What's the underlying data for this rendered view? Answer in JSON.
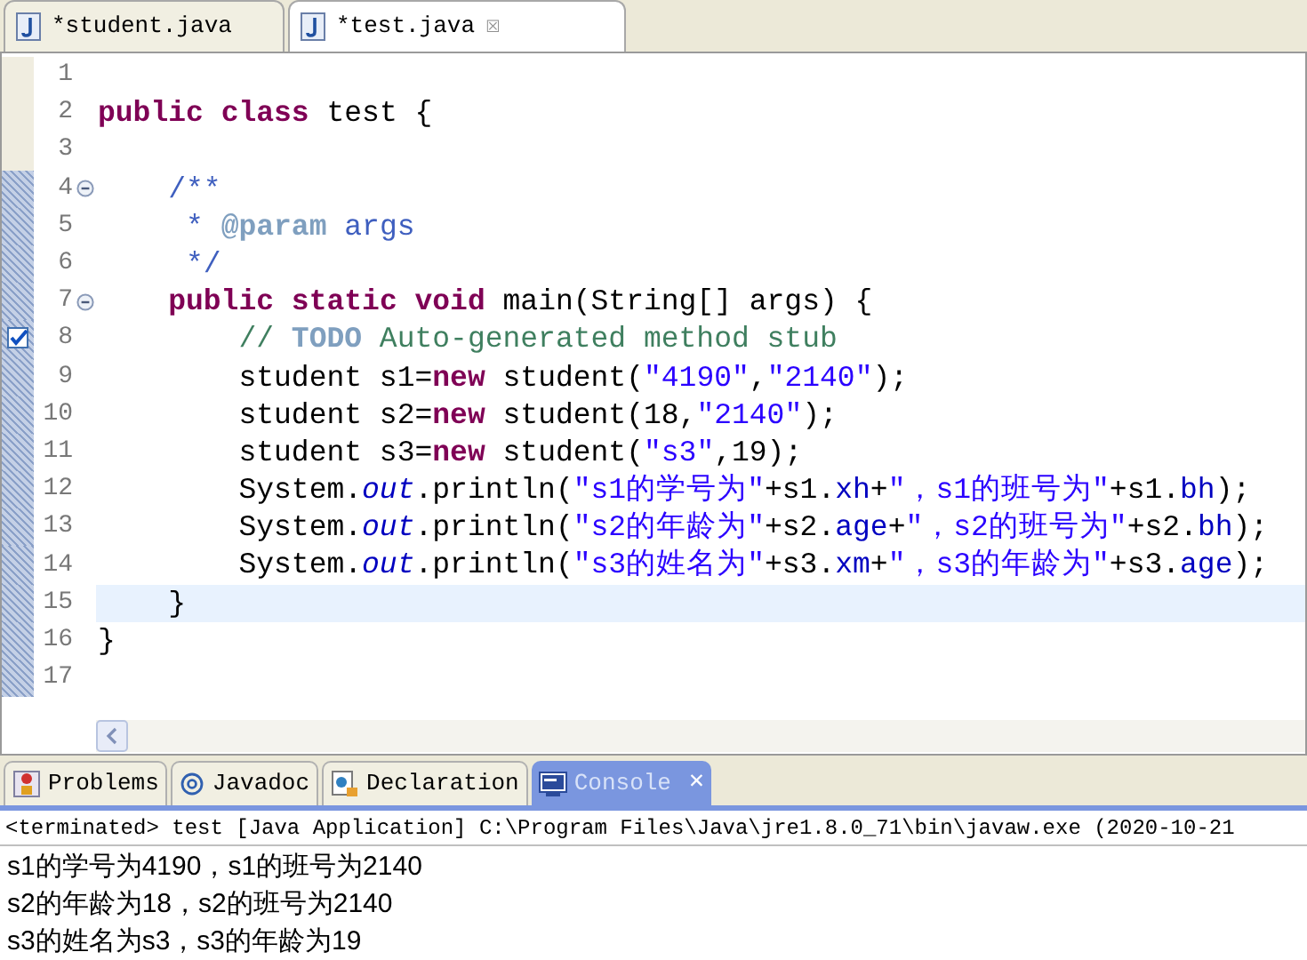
{
  "editor_tabs": [
    {
      "label": "*student.java",
      "selected": false
    },
    {
      "label": "*test.java",
      "selected": true,
      "close": "☒"
    }
  ],
  "code_lines": [
    {
      "number": "1",
      "current": false,
      "fold": false,
      "task": false,
      "in_range": false
    },
    {
      "number": "2",
      "current": false,
      "fold": false,
      "task": false,
      "in_range": false,
      "tokens": [
        {
          "kind": "keyword",
          "text": "public"
        },
        {
          "kind": "keyword",
          "text": " class"
        },
        {
          "kind": "plain",
          "text": " test {"
        }
      ]
    },
    {
      "number": "3",
      "current": false,
      "fold": false,
      "task": false,
      "in_range": false
    },
    {
      "number": "4",
      "current": false,
      "fold": true,
      "task": false,
      "in_range": true,
      "tokens": [
        {
          "kind": "javadoc",
          "text": "    /**"
        }
      ]
    },
    {
      "number": "5",
      "current": false,
      "fold": false,
      "task": false,
      "in_range": true,
      "tokens": [
        {
          "kind": "javadoc",
          "text": "     * "
        },
        {
          "kind": "doctag",
          "text": "@param"
        },
        {
          "kind": "javadoc",
          "text": " args"
        }
      ]
    },
    {
      "number": "6",
      "current": false,
      "fold": false,
      "task": false,
      "in_range": true,
      "tokens": [
        {
          "kind": "javadoc",
          "text": "     */"
        }
      ]
    },
    {
      "number": "7",
      "current": false,
      "fold": true,
      "task": false,
      "in_range": true,
      "tokens": [
        {
          "kind": "keyword",
          "text": "    public"
        },
        {
          "kind": "keyword",
          "text": " static"
        },
        {
          "kind": "keyword",
          "text": " void"
        },
        {
          "kind": "plain",
          "text": " main(String[] args) {"
        }
      ]
    },
    {
      "number": "8",
      "current": false,
      "fold": false,
      "task": true,
      "in_range": true,
      "tokens": [
        {
          "kind": "comment",
          "text": "        // "
        },
        {
          "kind": "todo",
          "text": "TODO"
        },
        {
          "kind": "comment",
          "text": " Auto-generated method stub"
        }
      ]
    },
    {
      "number": "9",
      "current": false,
      "fold": false,
      "task": false,
      "in_range": true,
      "tokens": [
        {
          "kind": "plain",
          "text": "        student s1="
        },
        {
          "kind": "keyword",
          "text": "new"
        },
        {
          "kind": "plain",
          "text": " student("
        },
        {
          "kind": "string",
          "text": "\"4190\""
        },
        {
          "kind": "plain",
          "text": ","
        },
        {
          "kind": "string",
          "text": "\"2140\""
        },
        {
          "kind": "plain",
          "text": ");"
        }
      ]
    },
    {
      "number": "10",
      "current": false,
      "fold": false,
      "task": false,
      "in_range": true,
      "tokens": [
        {
          "kind": "plain",
          "text": "        student s2="
        },
        {
          "kind": "keyword",
          "text": "new"
        },
        {
          "kind": "plain",
          "text": " student(18,"
        },
        {
          "kind": "string",
          "text": "\"2140\""
        },
        {
          "kind": "plain",
          "text": ");"
        }
      ]
    },
    {
      "number": "11",
      "current": false,
      "fold": false,
      "task": false,
      "in_range": true,
      "tokens": [
        {
          "kind": "plain",
          "text": "        student s3="
        },
        {
          "kind": "keyword",
          "text": "new"
        },
        {
          "kind": "plain",
          "text": " student("
        },
        {
          "kind": "string",
          "text": "\"s3\""
        },
        {
          "kind": "plain",
          "text": ",19);"
        }
      ]
    },
    {
      "number": "12",
      "current": false,
      "fold": false,
      "task": false,
      "in_range": true,
      "tokens": [
        {
          "kind": "plain",
          "text": "        System."
        },
        {
          "kind": "static",
          "text": "out"
        },
        {
          "kind": "plain",
          "text": ".println("
        },
        {
          "kind": "string",
          "text": "\"s1的学号为\""
        },
        {
          "kind": "plain",
          "text": "+s1."
        },
        {
          "kind": "field",
          "text": "xh"
        },
        {
          "kind": "plain",
          "text": "+"
        },
        {
          "kind": "string",
          "text": "\"，s1的班号为\""
        },
        {
          "kind": "plain",
          "text": "+s1."
        },
        {
          "kind": "field",
          "text": "bh"
        },
        {
          "kind": "plain",
          "text": ");"
        }
      ]
    },
    {
      "number": "13",
      "current": false,
      "fold": false,
      "task": false,
      "in_range": true,
      "tokens": [
        {
          "kind": "plain",
          "text": "        System."
        },
        {
          "kind": "static",
          "text": "out"
        },
        {
          "kind": "plain",
          "text": ".println("
        },
        {
          "kind": "string",
          "text": "\"s2的年龄为\""
        },
        {
          "kind": "plain",
          "text": "+s2."
        },
        {
          "kind": "field",
          "text": "age"
        },
        {
          "kind": "plain",
          "text": "+"
        },
        {
          "kind": "string",
          "text": "\"，s2的班号为\""
        },
        {
          "kind": "plain",
          "text": "+s2."
        },
        {
          "kind": "field",
          "text": "bh"
        },
        {
          "kind": "plain",
          "text": ");"
        }
      ]
    },
    {
      "number": "14",
      "current": false,
      "fold": false,
      "task": false,
      "in_range": true,
      "tokens": [
        {
          "kind": "plain",
          "text": "        System."
        },
        {
          "kind": "static",
          "text": "out"
        },
        {
          "kind": "plain",
          "text": ".println("
        },
        {
          "kind": "string",
          "text": "\"s3的姓名为\""
        },
        {
          "kind": "plain",
          "text": "+s3."
        },
        {
          "kind": "field",
          "text": "xm"
        },
        {
          "kind": "plain",
          "text": "+"
        },
        {
          "kind": "string",
          "text": "\"，s3的年龄为\""
        },
        {
          "kind": "plain",
          "text": "+s3."
        },
        {
          "kind": "field",
          "text": "age"
        },
        {
          "kind": "plain",
          "text": ");"
        }
      ]
    },
    {
      "number": "15",
      "current": true,
      "fold": false,
      "task": false,
      "in_range": true,
      "tokens": [
        {
          "kind": "plain",
          "text": "    }"
        }
      ]
    },
    {
      "number": "16",
      "current": false,
      "fold": false,
      "task": false,
      "in_range": true,
      "tokens": [
        {
          "kind": "plain",
          "text": "}"
        }
      ]
    },
    {
      "number": "17",
      "current": false,
      "fold": false,
      "task": false,
      "in_range": true
    }
  ],
  "view_tabs": [
    {
      "label": "Problems",
      "kind": "problems",
      "selected": false
    },
    {
      "label": "Javadoc",
      "kind": "javadoc",
      "selected": false
    },
    {
      "label": "Declaration",
      "kind": "declaration",
      "selected": false
    },
    {
      "label": "Console",
      "kind": "console",
      "selected": true,
      "close": "✕"
    }
  ],
  "console": {
    "header": "<terminated> test [Java Application] C:\\Program Files\\Java\\jre1.8.0_71\\bin\\javaw.exe (2020-10-21",
    "output": [
      "s1的学号为4190，s1的班号为2140",
      "s2的年龄为18，s2的班号为2140",
      "s3的姓名为s3，s3的年龄为19"
    ]
  }
}
